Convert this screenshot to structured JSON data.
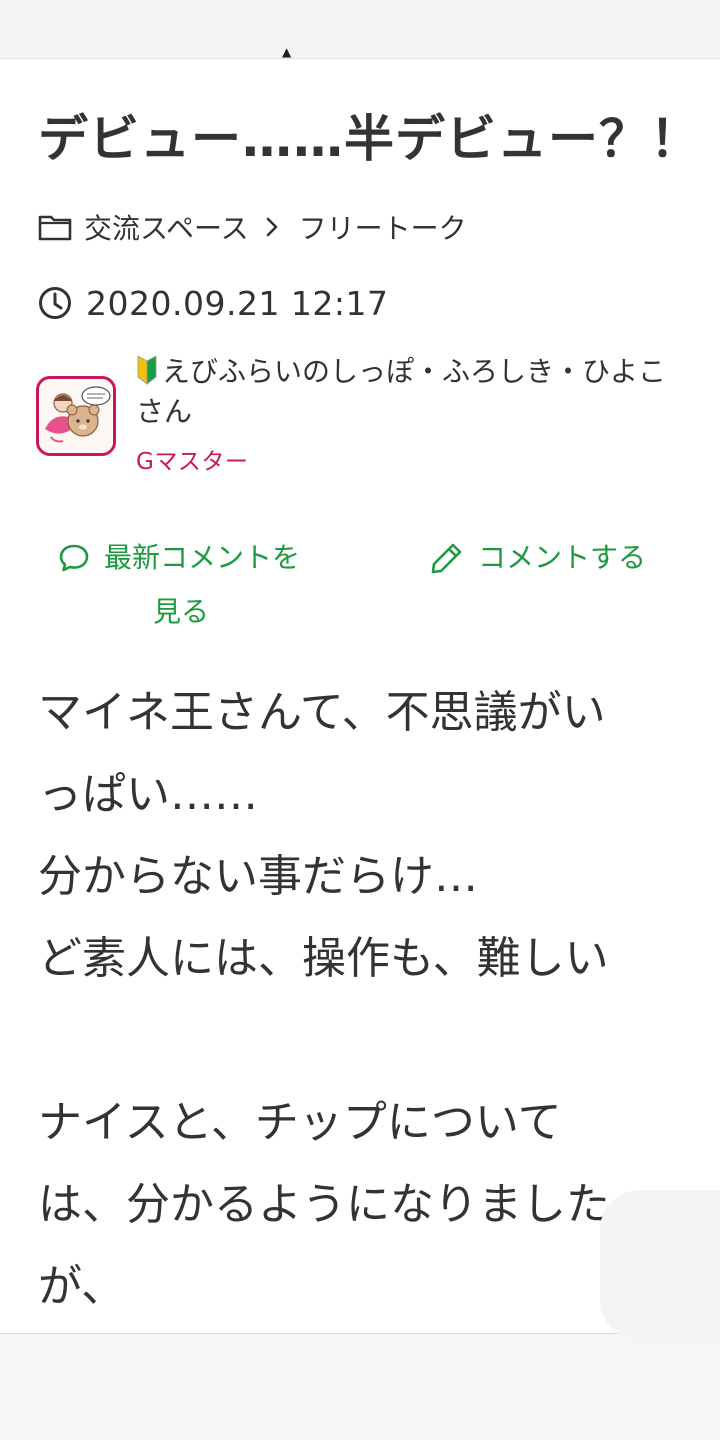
{
  "article": {
    "title": "デビュー……半デビュー？！",
    "breadcrumb": {
      "category": "交流スペース",
      "subcategory": "フリートーク"
    },
    "datetime": "2020.09.21 12:17",
    "author": {
      "name_line1": "えびふらいのしっぽ・ふろしき・ひよこ",
      "name_line2": "さん",
      "rank": "Gマスター"
    },
    "actions": {
      "latest_comments_line1": "最新コメントを",
      "latest_comments_line2": "見る",
      "comment": "コメントする"
    },
    "body": {
      "line1": "マイネ王さんて、不思議がい",
      "line2": "っぱい……",
      "line3": "分からない事だらけ…",
      "line4": "ど素人には、操作も、難しい",
      "line5": "ナイスと、チップについて",
      "line6": "は、分かるようになりました",
      "line7": "が、"
    }
  },
  "icons": {
    "folder": "folder-icon",
    "chevron": "chevron-right-icon",
    "clock": "clock-icon",
    "beginner": "beginner-mark-icon",
    "speech": "speech-bubble-icon",
    "pencil": "pencil-icon"
  },
  "colors": {
    "text": "#333333",
    "accent_green": "#1d9a3f",
    "rank_magenta": "#c8175d",
    "avatar_border": "#c8175d",
    "background": "#ffffff"
  }
}
